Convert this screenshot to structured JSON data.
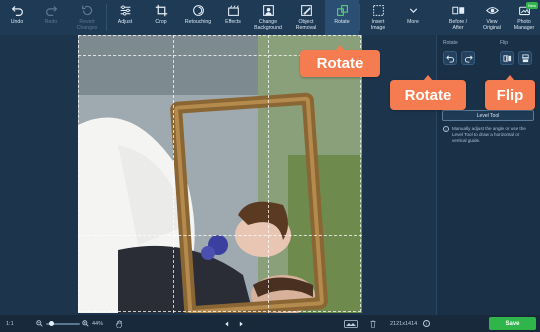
{
  "toolbar": {
    "items": [
      {
        "label": "Undo",
        "icon": "undo-icon"
      },
      {
        "label": "Redo",
        "icon": "redo-icon",
        "disabled": true
      },
      {
        "label": "Revert\nChanges",
        "icon": "revert-icon",
        "disabled": true
      },
      {
        "label": "Adjust",
        "icon": "sliders-icon"
      },
      {
        "label": "Crop",
        "icon": "crop-icon"
      },
      {
        "label": "Retouching",
        "icon": "retouch-icon"
      },
      {
        "label": "Effects",
        "icon": "effects-icon"
      },
      {
        "label": "Change\nBackground",
        "icon": "background-icon"
      },
      {
        "label": "Object\nRemoval",
        "icon": "object-removal-icon"
      },
      {
        "label": "Rotate",
        "icon": "rotate-icon",
        "active": true
      },
      {
        "label": "Insert\nImage",
        "icon": "insert-image-icon"
      },
      {
        "label": "More",
        "icon": "chevron-down-icon"
      },
      {
        "label": "Before /\nAfter",
        "icon": "before-after-icon"
      },
      {
        "label": "View\nOriginal",
        "icon": "eye-icon"
      },
      {
        "label": "Photo\nManager",
        "icon": "photo-manager-icon",
        "badge": "New"
      }
    ]
  },
  "panel": {
    "rotate_title": "Rotate",
    "flip_title": "Flip",
    "level_tool_label": "Level Tool",
    "info_text": "Manually adjust the angle or use the Level Tool to draw a horizontal or vertical guide."
  },
  "callouts": {
    "rotate_toolbar": "Rotate",
    "rotate_panel": "Rotate",
    "flip_panel": "Flip"
  },
  "bottombar": {
    "ratio_label": "1:1",
    "zoom_percent": "44%",
    "zoom_level": 0.12,
    "image_size": "2121x1414",
    "save_label": "Save"
  },
  "colors": {
    "accent_callout": "#f47c50",
    "save_green": "#2fb54a",
    "toolbar_bg": "#1f3a55",
    "panel_bg": "#1a3046"
  }
}
